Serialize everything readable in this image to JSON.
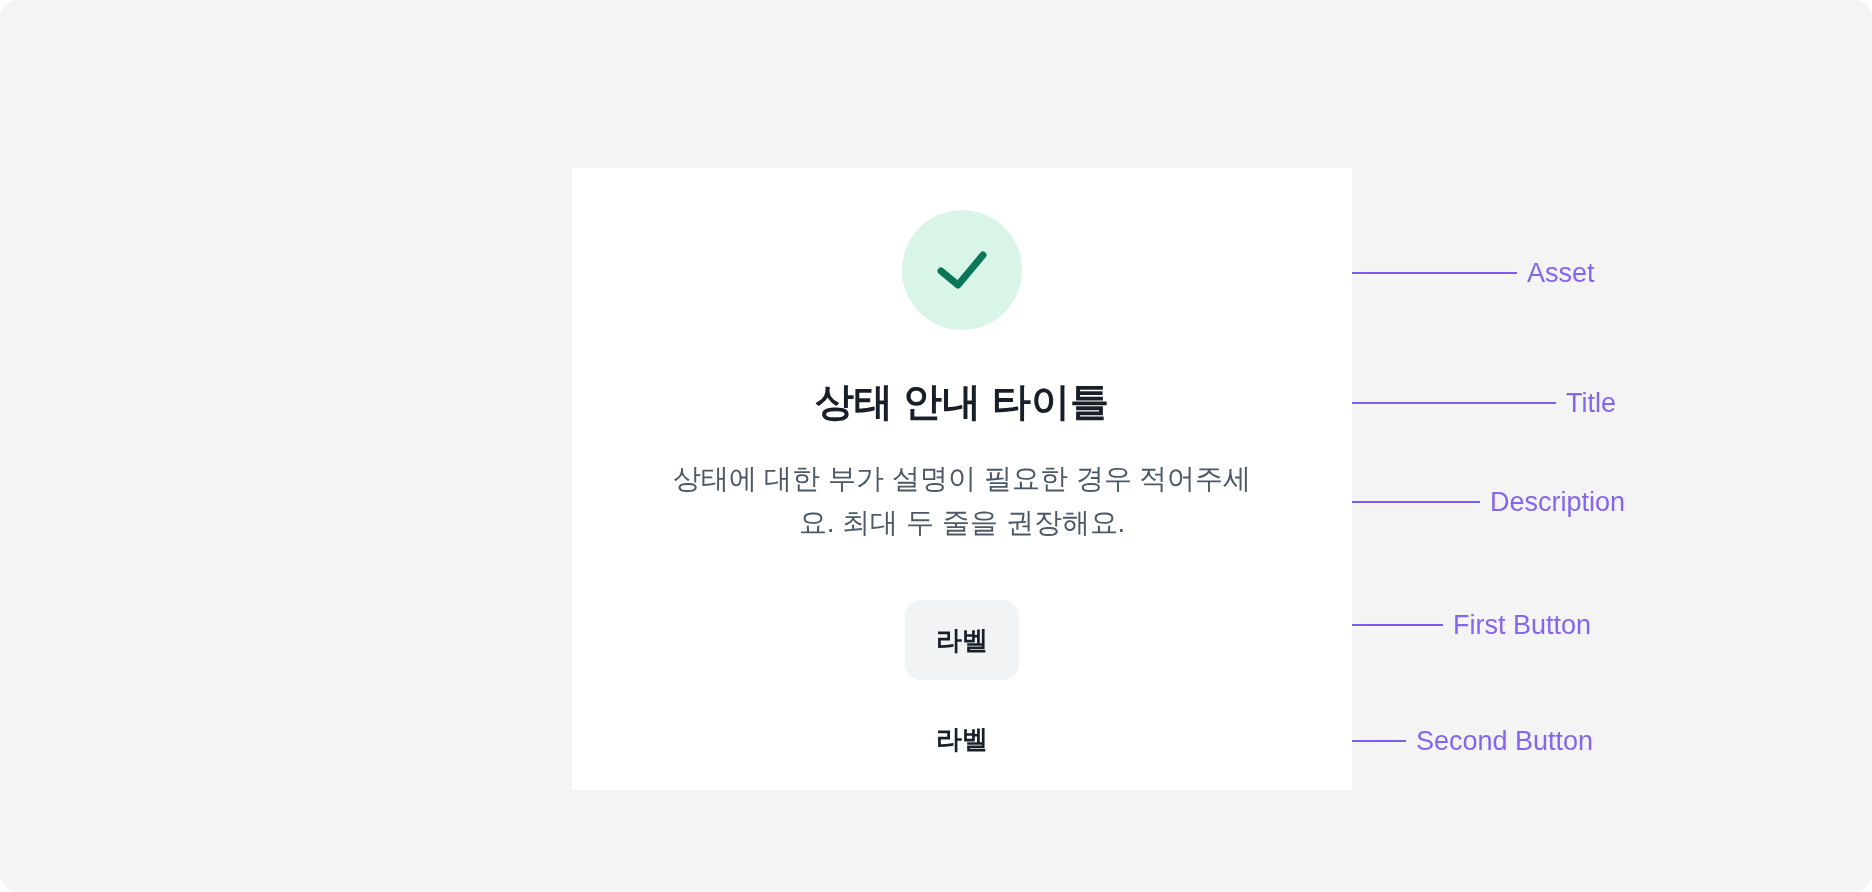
{
  "dialog": {
    "asset": {
      "kind": "success"
    },
    "title": "상태 안내 타이틀",
    "description": "상태에 대한 부가 설명이 필요한 경우 적어주세요. 최대 두 줄을 권장해요.",
    "buttons": [
      {
        "label": "라벨",
        "kind": "filled"
      },
      {
        "label": "라벨",
        "kind": "text"
      }
    ]
  },
  "annotations": [
    {
      "label": "Asset"
    },
    {
      "label": "Title"
    },
    {
      "label": "Description"
    },
    {
      "label": "First Button"
    },
    {
      "label": "Second Button"
    }
  ]
}
